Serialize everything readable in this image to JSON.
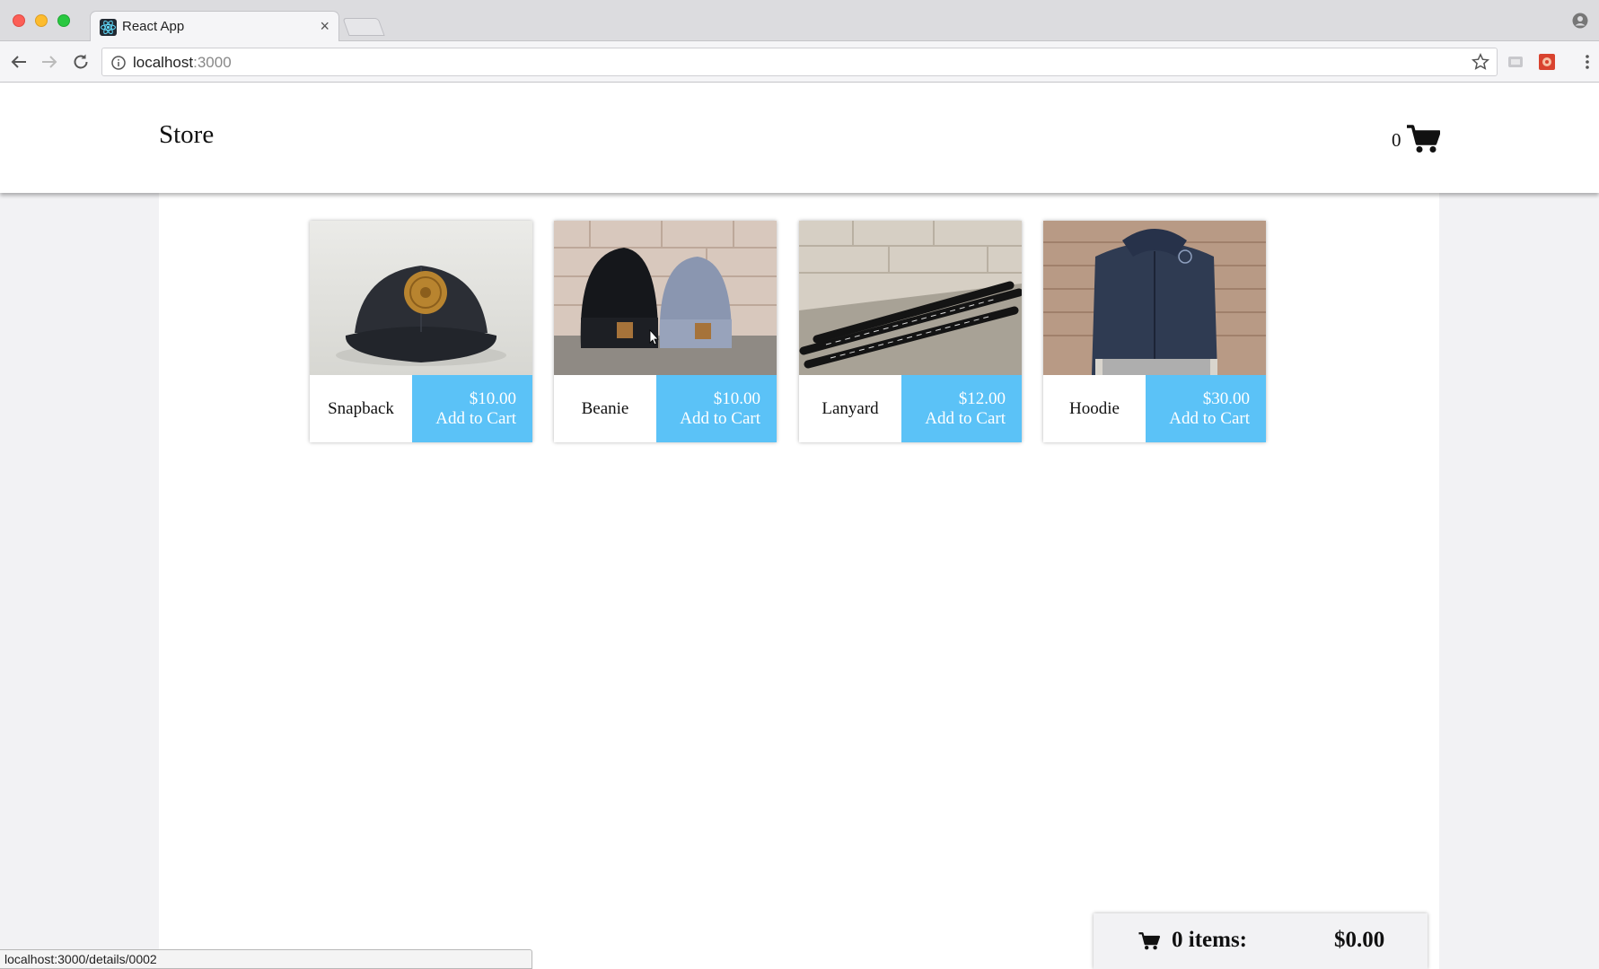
{
  "browser": {
    "tab_title": "React App",
    "tab_close": "×",
    "url_host": "localhost",
    "url_port": ":3000",
    "status_url": "localhost:3000/details/0002"
  },
  "header": {
    "title": "Store",
    "cart_count": "0",
    "cart_icon": "shopping-cart-icon"
  },
  "products": [
    {
      "name": "Snapback",
      "price": "$10.00",
      "action": "Add to Cart",
      "image": "snapback-cap-photo"
    },
    {
      "name": "Beanie",
      "price": "$10.00",
      "action": "Add to Cart",
      "image": "beanies-photo"
    },
    {
      "name": "Lanyard",
      "price": "$12.00",
      "action": "Add to Cart",
      "image": "lanyards-photo"
    },
    {
      "name": "Hoodie",
      "price": "$30.00",
      "action": "Add to Cart",
      "image": "hoodie-photo"
    }
  ],
  "cart_summary": {
    "items_label": "0 items:",
    "total": "$0.00"
  },
  "colors": {
    "accent": "#5bc2f7",
    "page_bg": "#f2f2f4"
  }
}
